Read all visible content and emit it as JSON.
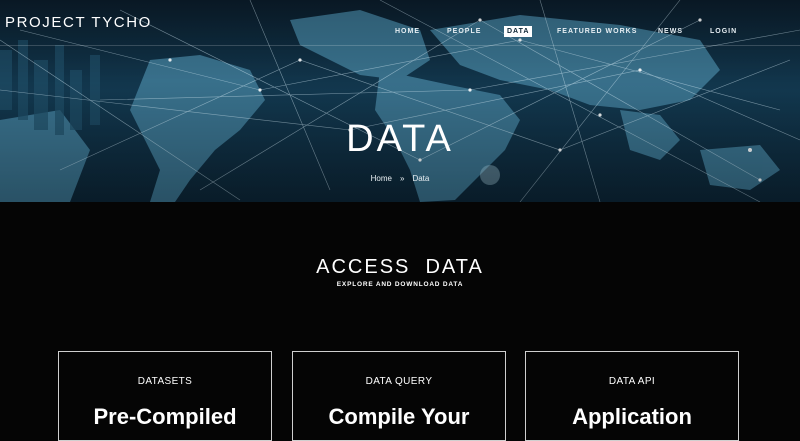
{
  "header": {
    "brand": "PROJECT TYCHO",
    "nav": [
      {
        "label": "HOME",
        "active": false
      },
      {
        "label": "PEOPLE",
        "active": false
      },
      {
        "label": "DATA",
        "active": true
      },
      {
        "label": "FEATURED WORKS",
        "active": false
      },
      {
        "label": "NEWS",
        "active": false
      },
      {
        "label": "LOGIN",
        "active": false
      }
    ]
  },
  "hero": {
    "title": "DATA",
    "breadcrumb": {
      "home": "Home",
      "separator": "»",
      "current": "Data"
    }
  },
  "section": {
    "title": "ACCESS  DATA",
    "subtitle": "EXPLORE AND DOWNLOAD DATA"
  },
  "cards": [
    {
      "label": "DATASETS",
      "heading": "Pre-Compiled"
    },
    {
      "label": "DATA QUERY",
      "heading": "Compile Your"
    },
    {
      "label": "DATA API",
      "heading": "Application"
    }
  ],
  "colors": {
    "background": "#050505",
    "hero_blue": "#12384f",
    "active_nav_bg": "#ffffff",
    "active_nav_text": "#0d2433"
  }
}
